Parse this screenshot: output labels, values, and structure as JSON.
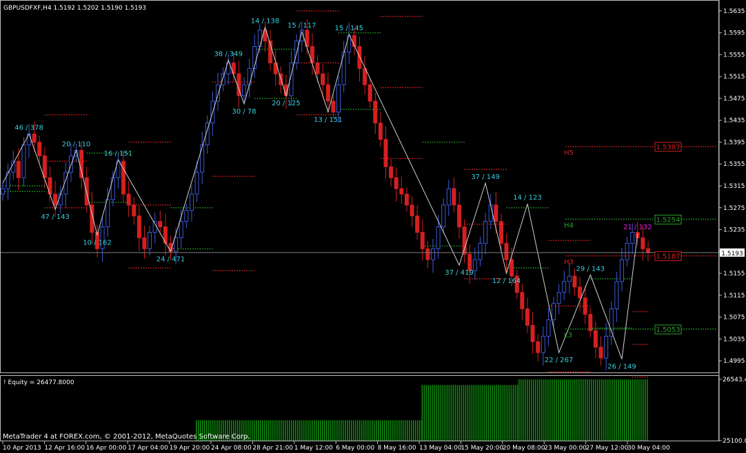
{
  "chart_data": {
    "type": "candlestick",
    "symbol_line": "GBPUSDFXF,H4  1.5192 1.5202 1.5190 1.5193",
    "copyright": "MetaTrader 4 at FOREX.com, © 2001-2012, MetaQuotes Software Corp.",
    "ylim": [
      1.498,
      1.565
    ],
    "y_ticks": [
      "1.5635",
      "1.5595",
      "1.5555",
      "1.5515",
      "1.5475",
      "1.5435",
      "1.5395",
      "1.5355",
      "1.5315",
      "1.5275",
      "1.5235",
      "1.5195",
      "1.5155",
      "1.5115",
      "1.5075",
      "1.5035",
      "1.4995"
    ],
    "current_price": "1.5193",
    "x_ticks": [
      "10 Apr 2013",
      "12 Apr 16:00",
      "16 Apr 00:00",
      "17 Apr 04:00",
      "19 Apr 20:00",
      "24 Apr 08:00",
      "28 Apr 21:00",
      "1 May 12:00",
      "6 May 00:00",
      "8 May 16:00",
      "13 May 04:00",
      "15 May 20:00",
      "20 May 08:00",
      "23 May 00:00",
      "27 May 12:00",
      "30 May 04:00"
    ],
    "price_path": [
      1.531,
      1.534,
      1.536,
      1.533,
      1.539,
      1.541,
      1.5395,
      1.537,
      1.533,
      1.53,
      1.528,
      1.53,
      1.534,
      1.537,
      1.538,
      1.533,
      1.528,
      1.523,
      1.52,
      1.524,
      1.529,
      1.533,
      1.536,
      1.53,
      1.528,
      1.526,
      1.522,
      1.52,
      1.523,
      1.525,
      1.524,
      1.521,
      1.5195,
      1.522,
      1.525,
      1.527,
      1.53,
      1.534,
      1.539,
      1.543,
      1.547,
      1.55,
      1.552,
      1.554,
      1.552,
      1.548,
      1.55,
      1.553,
      1.557,
      1.56,
      1.558,
      1.554,
      1.552,
      1.55,
      1.548,
      1.554,
      1.558,
      1.56,
      1.557,
      1.554,
      1.552,
      1.55,
      1.547,
      1.545,
      1.55,
      1.556,
      1.559,
      1.557,
      1.553,
      1.55,
      1.547,
      1.543,
      1.54,
      1.535,
      1.533,
      1.531,
      1.53,
      1.528,
      1.526,
      1.523,
      1.52,
      1.518,
      1.52,
      1.524,
      1.528,
      1.531,
      1.528,
      1.524,
      1.519,
      1.516,
      1.518,
      1.521,
      1.525,
      1.528,
      1.525,
      1.521,
      1.518,
      1.515,
      1.512,
      1.509,
      1.506,
      1.503,
      1.501,
      1.504,
      1.507,
      1.51,
      1.512,
      1.514,
      1.515,
      1.513,
      1.511,
      1.508,
      1.505,
      1.502,
      1.5,
      1.504,
      1.509,
      1.514,
      1.518,
      1.521,
      1.523,
      1.522,
      1.52,
      1.5193
    ],
    "zigzag": [
      {
        "i": 0,
        "p": 1.532,
        "label": ""
      },
      {
        "i": 5,
        "p": 1.541,
        "label": "46 / 378"
      },
      {
        "i": 10,
        "p": 1.5272,
        "label": "47 / 143"
      },
      {
        "i": 14,
        "p": 1.538,
        "label": "20 / 110"
      },
      {
        "i": 18,
        "p": 1.5225,
        "label": "10 / 162"
      },
      {
        "i": 22,
        "p": 1.5363,
        "label": "16 / 151"
      },
      {
        "i": 32,
        "p": 1.5195,
        "label": "24 / 471"
      },
      {
        "i": 43,
        "p": 1.5545,
        "label": "38 / 349"
      },
      {
        "i": 46,
        "p": 1.5465,
        "label": "30 / 78"
      },
      {
        "i": 50,
        "p": 1.5605,
        "label": "14 / 138"
      },
      {
        "i": 54,
        "p": 1.548,
        "label": "20 / 125"
      },
      {
        "i": 57,
        "p": 1.5597,
        "label": "15 / 117"
      },
      {
        "i": 62,
        "p": 1.545,
        "label": "13 / 151"
      },
      {
        "i": 66,
        "p": 1.5592,
        "label": "15 / 145"
      },
      {
        "i": 87,
        "p": 1.517,
        "label": "37 / 419"
      },
      {
        "i": 92,
        "p": 1.532,
        "label": "37 / 149"
      },
      {
        "i": 96,
        "p": 1.5155,
        "label": "12 / 164"
      },
      {
        "i": 100,
        "p": 1.5282,
        "label": "14 / 123"
      },
      {
        "i": 106,
        "p": 1.501,
        "label": "22 / 267"
      },
      {
        "i": 112,
        "p": 1.5152,
        "label": "29 / 143"
      },
      {
        "i": 118,
        "p": 1.4998,
        "label": "26 / 149"
      },
      {
        "i": 121,
        "p": 1.5228,
        "label": "21 / 132"
      }
    ],
    "levels": [
      {
        "label": "H5",
        "value": "1.5387",
        "color": "#d42020"
      },
      {
        "label": "H4",
        "value": "1.5254",
        "color": "#2ea02e"
      },
      {
        "label": "H3",
        "value": "1.5187",
        "color": "#d42020"
      },
      {
        "label": "L3",
        "value": "1.5053",
        "color": "#2ea02e"
      }
    ],
    "indicator": {
      "title": "! Equity = 26477.8000",
      "ylim": [
        25100.0,
        26543.4
      ],
      "y_ticks": [
        "26543.4",
        "25100.0"
      ],
      "steps": [
        {
          "from": 0.0,
          "to": 0.3,
          "value": 25100.0
        },
        {
          "from": 0.3,
          "to": 0.65,
          "value": 25580.0
        },
        {
          "from": 0.65,
          "to": 0.8,
          "value": 26410.0
        },
        {
          "from": 0.8,
          "to": 1.0,
          "value": 26543.4
        }
      ]
    },
    "colors": {
      "up": "#3b5bd9",
      "down": "#d42020",
      "zigzag": "#d0d0d0",
      "label": "#35d0e0",
      "magenta": "#e020e0",
      "dot_red": "#e02020",
      "dot_green": "#1fa51f",
      "frame": "#bdbdbd",
      "text": "#ffffff",
      "bar": "#0f8a0f"
    }
  }
}
